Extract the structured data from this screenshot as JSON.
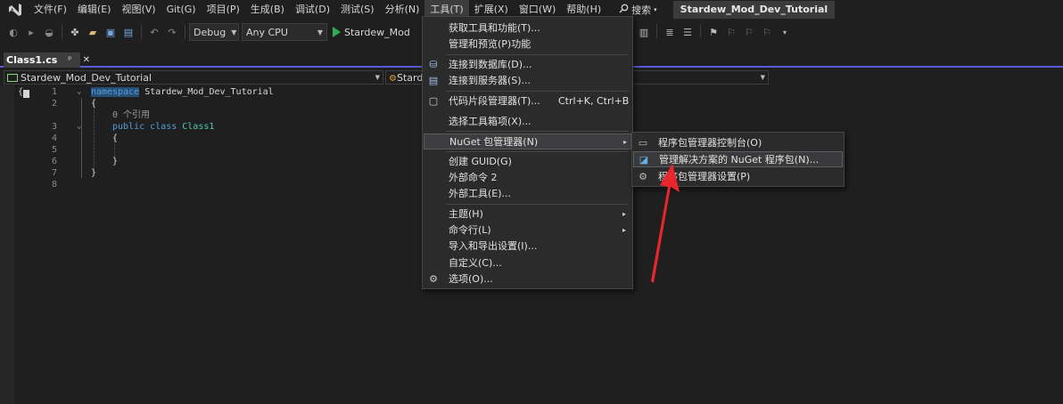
{
  "menubar": {
    "items": [
      "文件(F)",
      "编辑(E)",
      "视图(V)",
      "Git(G)",
      "项目(P)",
      "生成(B)",
      "调试(D)",
      "测试(S)",
      "分析(N)",
      "工具(T)",
      "扩展(X)",
      "窗口(W)",
      "帮助(H)"
    ],
    "search_label": "搜索",
    "solution_name": "Stardew_Mod_Dev_Tutorial"
  },
  "toolbar": {
    "config": "Debug",
    "platform": "Any CPU",
    "run_target": "Stardew_Mod"
  },
  "tab": {
    "title": "Class1.cs",
    "pin": "ᵖ",
    "close": "✕"
  },
  "navbar": {
    "project": "Stardew_Mod_Dev_Tutorial",
    "type": "Stard"
  },
  "editor": {
    "line_numbers": [
      "1",
      "2",
      "3",
      "4",
      "5",
      "6",
      "7",
      "8"
    ],
    "ns_keyword": "namespace",
    "ns_name": " Stardew_Mod_Dev_Tutorial",
    "open_brace": "{",
    "close_brace": "}",
    "ref_count": "0 个引用",
    "class_keywords": "public class",
    "class_name": " Class1"
  },
  "tools_menu": {
    "items": [
      {
        "label": "获取工具和功能(T)..."
      },
      {
        "label": "管理和预览(P)功能"
      },
      {
        "label": "连接到数据库(D)...",
        "icon": "database-connect-icon"
      },
      {
        "label": "连接到服务器(S)...",
        "icon": "server-connect-icon"
      },
      {
        "label": "代码片段管理器(T)...",
        "shortcut": "Ctrl+K, Ctrl+B",
        "icon": "snippet-manager-icon"
      },
      {
        "label": "选择工具箱项(X)..."
      },
      {
        "label": "NuGet 包管理器(N)",
        "submenu": "▸"
      },
      {
        "label": "创建 GUID(G)"
      },
      {
        "label": "外部命令 2"
      },
      {
        "label": "外部工具(E)..."
      },
      {
        "label": "主题(H)",
        "submenu": "▸"
      },
      {
        "label": "命令行(L)",
        "submenu": "▸"
      },
      {
        "label": "导入和导出设置(I)..."
      },
      {
        "label": "自定义(C)..."
      },
      {
        "label": "选项(O)...",
        "icon": "gear-icon"
      }
    ]
  },
  "nuget_submenu": {
    "items": [
      {
        "label": "程序包管理器控制台(O)",
        "icon": "console-icon"
      },
      {
        "label": "管理解决方案的 NuGet 程序包(N)...",
        "icon": "nuget-icon"
      },
      {
        "label": "程序包管理器设置(P)",
        "icon": "gear-icon"
      }
    ]
  },
  "colors": {
    "accent": "#5a5ad6",
    "annotation_arrow": "#e8262c",
    "keyword": "#569cd6",
    "type": "#4ec9b0"
  }
}
